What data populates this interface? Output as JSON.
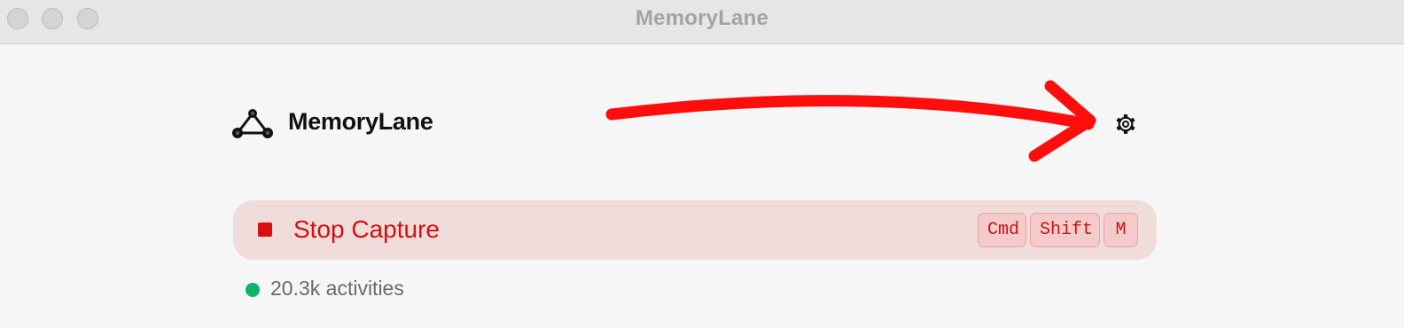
{
  "window": {
    "title": "MemoryLane"
  },
  "header": {
    "app_name": "MemoryLane",
    "logo_icon": "triangle-nodes-icon",
    "settings_icon": "gear-icon"
  },
  "capture": {
    "label": "Stop Capture",
    "icon": "stop-square-icon",
    "shortcut_keys": [
      "Cmd",
      "Shift",
      "M"
    ]
  },
  "status": {
    "text": "20.3k activities",
    "indicator_color": "#10b26a"
  },
  "colors": {
    "accent_red": "#d31010",
    "capture_bg": "#f1dcdc",
    "annotation_arrow": "#ff0d0d"
  }
}
